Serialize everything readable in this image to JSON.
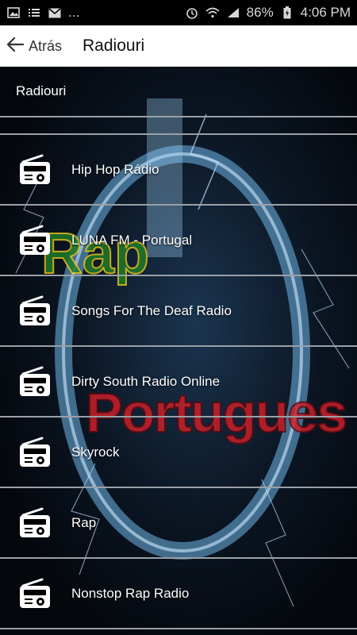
{
  "status_bar": {
    "ellipsis": "...",
    "battery": "86%",
    "time": "4:06 PM",
    "icons": [
      "image-icon",
      "list-icon",
      "mail-icon",
      "alarm-icon",
      "wifi-icon",
      "signal-icon",
      "battery-icon"
    ]
  },
  "app_bar": {
    "back_label": "Atrás",
    "title": "Radiouri"
  },
  "background_art": {
    "line1": "Rap",
    "line2": "Portugues"
  },
  "section": {
    "header": "Radiouri"
  },
  "stations": [
    {
      "label": "Hip Hop Rádio",
      "icon": "radio-icon"
    },
    {
      "label": "LUNA FM - Portugal",
      "icon": "radio-icon"
    },
    {
      "label": "Songs For The Deaf Radio",
      "icon": "radio-icon"
    },
    {
      "label": "Dirty South Radio Online",
      "icon": "radio-icon"
    },
    {
      "label": "Skyrock",
      "icon": "radio-icon"
    },
    {
      "label": "Rap",
      "icon": "radio-icon"
    },
    {
      "label": "Nonstop Rap Radio",
      "icon": "radio-icon"
    }
  ],
  "colors": {
    "app_bar_bg": "#ffffff",
    "divider": "#9aa0a6",
    "text": "#ffffff",
    "art_red": "#c8202a",
    "art_green": "#1f7a2a",
    "art_yellow": "#e6c21b",
    "art_blue": "#1e6fb8"
  }
}
